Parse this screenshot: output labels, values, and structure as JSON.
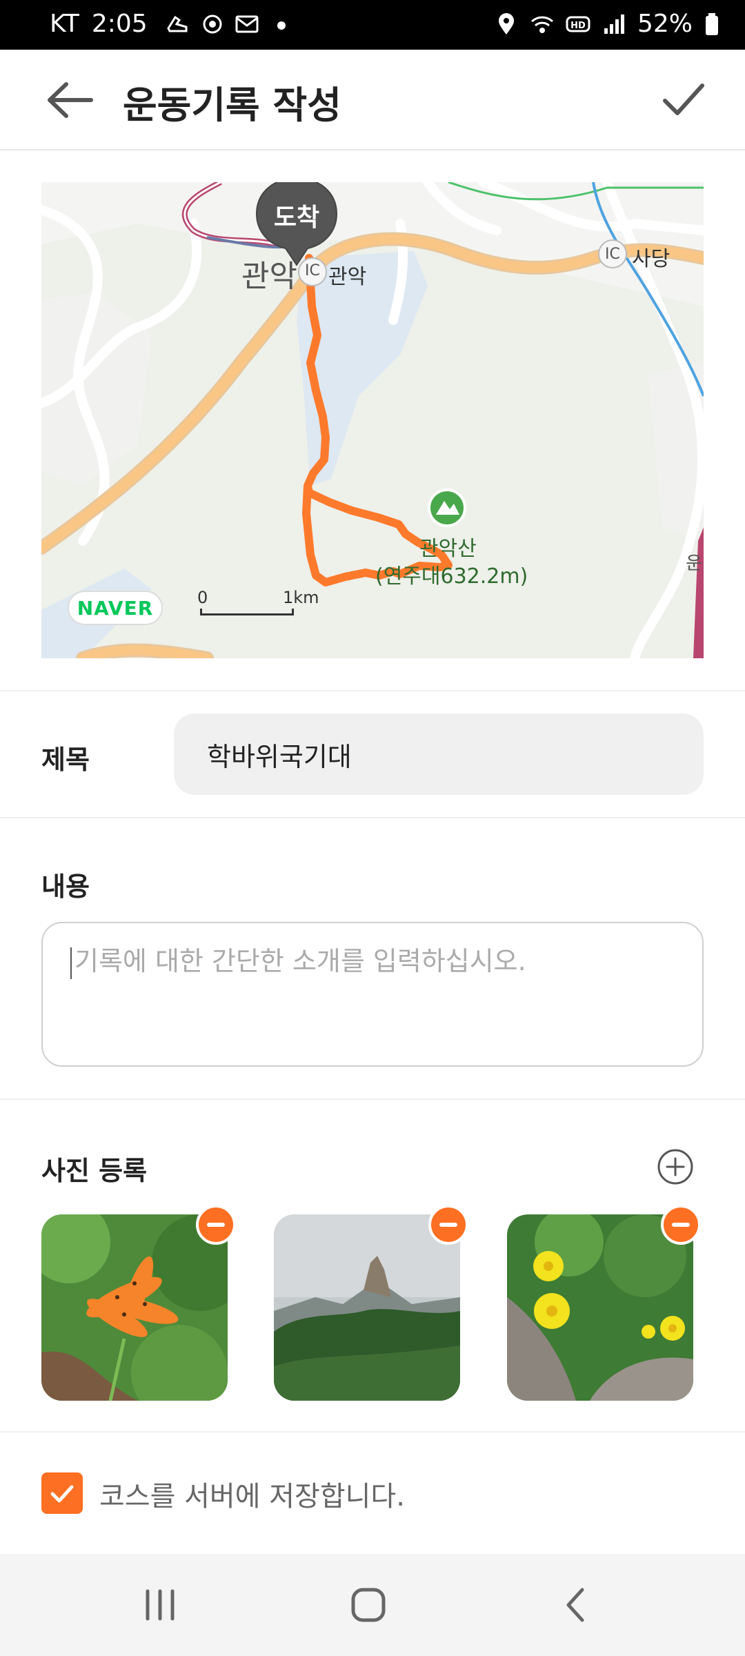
{
  "status_bar": {
    "carrier": "KT",
    "time": "2:05",
    "battery": "52%",
    "icons": [
      "shoe-icon",
      "sync-icon",
      "mail-icon",
      "dot-icon",
      "location-icon",
      "wifi-icon",
      "hd-icon",
      "signal-icon",
      "battery-icon"
    ]
  },
  "header": {
    "title": "운동기록 작성",
    "back_icon": "arrow-left-icon",
    "confirm_icon": "check-icon"
  },
  "map": {
    "end_marker": "도착",
    "place_labels": {
      "station": "관악",
      "ic_gwanak": "관악",
      "ic_sadang": "사당",
      "ic_badge": "IC",
      "mountain_name": "관악산",
      "mountain_detail": "(연주대632.2m)",
      "edge_label": "운"
    },
    "provider": "NAVER",
    "scale_start": "0",
    "scale_end": "1km",
    "route_color": "#fd7a2c"
  },
  "form": {
    "title_label": "제목",
    "title_value": "학바위국기대",
    "content_label": "내용",
    "content_placeholder": "기록에 대한 간단한 소개를 입력하십시오.",
    "photos_label": "사진 등록",
    "photos": [
      {
        "subject": "orange tiger lily"
      },
      {
        "subject": "rocky mountain peak"
      },
      {
        "subject": "yellow wildflowers"
      }
    ],
    "save_course_label": "코스를 서버에 저장합니다.",
    "save_course_checked": true
  },
  "nav_bar": {
    "icons": [
      "recent-apps-icon",
      "home-icon",
      "back-icon"
    ]
  },
  "colors": {
    "accent": "#fd6f22",
    "naver_green": "#03c75a",
    "field_bg": "#f0f0f0"
  }
}
